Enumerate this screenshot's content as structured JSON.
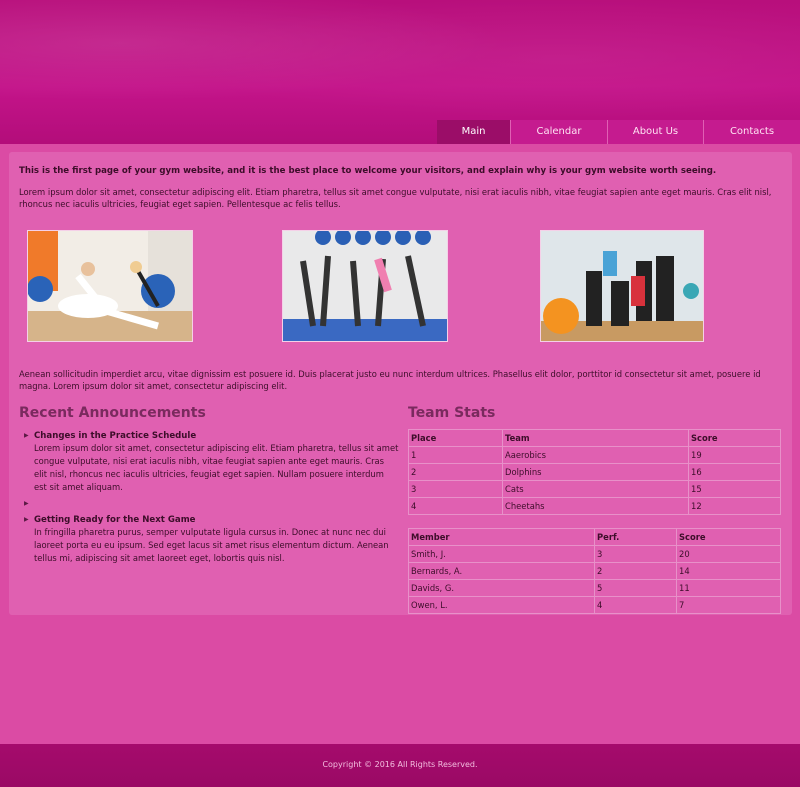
{
  "nav": {
    "tabs": [
      {
        "label": "Main",
        "active": true
      },
      {
        "label": "Calendar",
        "active": false
      },
      {
        "label": "About Us",
        "active": false
      },
      {
        "label": "Contacts",
        "active": false
      }
    ]
  },
  "intro": {
    "headline": "This is the first page of your gym website, and it is the best place to welcome your visitors, and explain why is your gym website worth seeing.",
    "paragraph": "Lorem ipsum dolor sit amet, consectetur adipiscing elit. Etiam pharetra, tellus sit amet congue vulputate, nisi erat iaculis nibh, vitae feugiat sapien ante eget mauris. Cras elit nisl, rhoncus nec iaculis ultricies, feugiat eget sapien. Pellentesque ac felis tellus.",
    "paragraph2": "Aenean sollicitudin imperdiet arcu, vitae dignissim est posuere id. Duis placerat justo eu nunc interdum ultrices. Phasellus elit dolor, porttitor id consectetur sit amet, posuere id magna. Lorem ipsum dolor sit amet, consectetur adipiscing elit."
  },
  "announcements": {
    "title": "Recent Announcements",
    "items": [
      {
        "title": "Changes in the Practice Schedule",
        "body": "Lorem ipsum dolor sit amet, consectetur adipiscing elit. Etiam pharetra, tellus sit amet congue vulputate, nisi erat iaculis nibh, vitae feugiat sapien ante eget mauris. Cras elit nisl, rhoncus nec iaculis ultricies, feugiat eget sapien. Nullam posuere interdum est sit amet aliquam."
      },
      {
        "title": "Getting Ready for the Next Game",
        "body": "In fringilla pharetra purus, semper vulputate ligula cursus in. Donec at nunc nec dui laoreet porta eu eu ipsum. Sed eget lacus sit amet risus elementum dictum. Aenean tellus mi, adipiscing sit amet laoreet eget, lobortis quis nisl."
      }
    ]
  },
  "team_stats": {
    "title": "Team Stats",
    "teams": {
      "headers": [
        "Place",
        "Team",
        "Score"
      ],
      "rows": [
        [
          "1",
          "Aaerobics",
          "19"
        ],
        [
          "2",
          "Dolphins",
          "16"
        ],
        [
          "3",
          "Cats",
          "15"
        ],
        [
          "4",
          "Cheetahs",
          "12"
        ]
      ]
    },
    "members": {
      "headers": [
        "Member",
        "Perf.",
        "Score"
      ],
      "rows": [
        [
          "Smith, J.",
          "3",
          "20"
        ],
        [
          "Bernards, A.",
          "2",
          "14"
        ],
        [
          "Davids, G.",
          "5",
          "11"
        ],
        [
          "Owen, L.",
          "4",
          "7"
        ]
      ]
    }
  },
  "footer": {
    "copyright": "Copyright © 2016 All Rights Reserved."
  },
  "colors": {
    "header": "#c4148a",
    "page": "#db4ba4",
    "active_tab": "#9b0d68",
    "footer": "#a50b6c"
  }
}
